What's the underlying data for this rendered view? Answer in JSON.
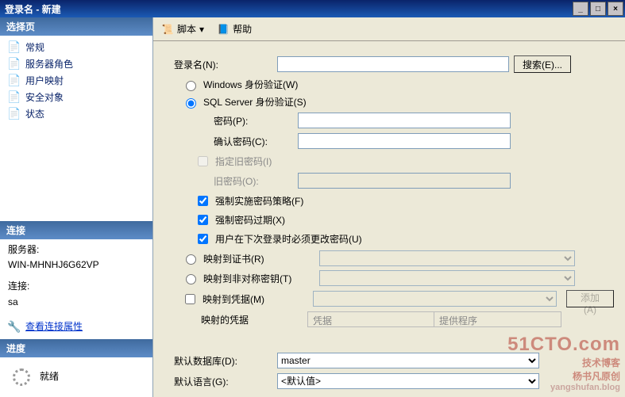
{
  "window": {
    "title": "登录名 - 新建"
  },
  "win_buttons": {
    "min": "_",
    "max": "□",
    "close": "×"
  },
  "left": {
    "select_page": "选择页",
    "pages": [
      {
        "icon": "📄",
        "label": "常规"
      },
      {
        "icon": "📄",
        "label": "服务器角色"
      },
      {
        "icon": "📄",
        "label": "用户映射"
      },
      {
        "icon": "📄",
        "label": "安全对象"
      },
      {
        "icon": "📄",
        "label": "状态"
      }
    ],
    "conn_hdr": "连接",
    "server_lbl": "服务器:",
    "server_val": "WIN-MHNHJ6G62VP",
    "conn_lbl": "连接:",
    "conn_val": "sa",
    "view_props": "查看连接属性",
    "progress_hdr": "进度",
    "ready": "就绪"
  },
  "toolbar": {
    "script": "脚本",
    "help": "帮助",
    "dropdown": "▾"
  },
  "form": {
    "login_name": "登录名(N):",
    "search": "搜索(E)...",
    "win_auth": "Windows 身份验证(W)",
    "sql_auth": "SQL Server 身份验证(S)",
    "password": "密码(P):",
    "confirm": "确认密码(C):",
    "specify_old": "指定旧密码(I)",
    "old_pwd": "旧密码(O):",
    "enforce_policy": "强制实施密码策略(F)",
    "enforce_expire": "强制密码过期(X)",
    "must_change": "用户在下次登录时必须更改密码(U)",
    "map_cert": "映射到证书(R)",
    "map_asym": "映射到非对称密钥(T)",
    "map_cred": "映射到凭据(M)",
    "add": "添加(A)",
    "mapped_creds": "映射的凭据",
    "cred_col": "凭据",
    "prov_col": "提供程序",
    "default_db": "默认数据库(D):",
    "default_db_val": "master",
    "default_lang": "默认语言(G):",
    "default_lang_val": "<默认值>"
  },
  "watermark": {
    "l1": "51CTO.com",
    "l2": "技术博客",
    "l3": "yangshufan.blog",
    "l4": "杨书凡原创"
  }
}
